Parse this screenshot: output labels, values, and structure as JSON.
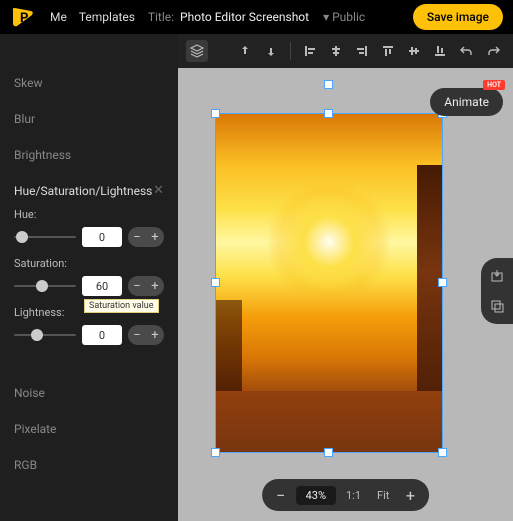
{
  "topbar": {
    "nav": {
      "me": "Me",
      "templates": "Templates"
    },
    "title_label": "Title:",
    "title_value": "Photo Editor Screenshot",
    "visibility": "Public",
    "save": "Save image"
  },
  "sidebar": {
    "items_above": [
      "Skew",
      "Blur",
      "Brightness"
    ],
    "hsl": {
      "header": "Hue/Saturation/Lightness",
      "hue": {
        "label": "Hue:",
        "value": "0",
        "pos": 3
      },
      "saturation": {
        "label": "Saturation:",
        "value": "60",
        "pos": 36,
        "tooltip": "Saturation value"
      },
      "lightness": {
        "label": "Lightness:",
        "value": "0",
        "pos": 28
      }
    },
    "items_below": [
      "Noise",
      "Pixelate",
      "RGB"
    ]
  },
  "canvas": {
    "animate": "Animate",
    "hot": "HOT",
    "zoom": {
      "pct": "43%",
      "one": "1:1",
      "fit": "Fit"
    }
  }
}
